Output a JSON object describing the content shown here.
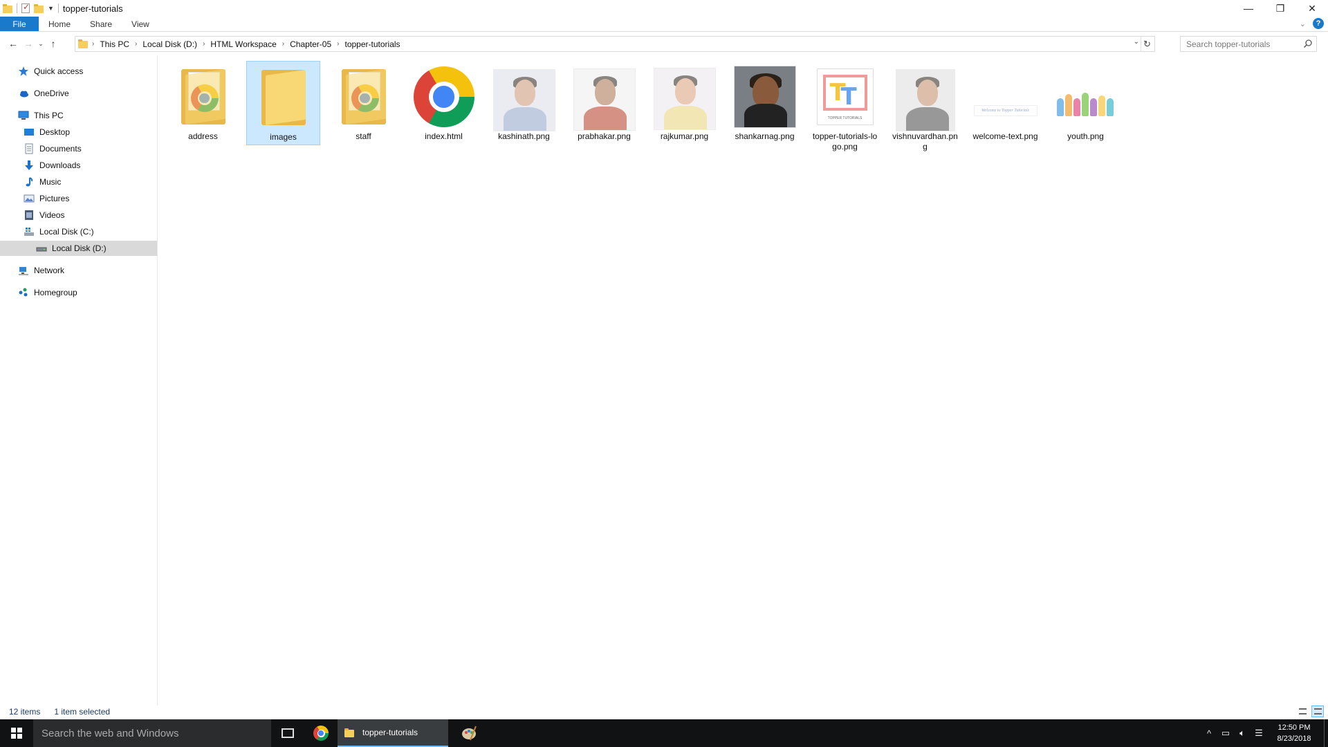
{
  "window": {
    "title": "topper-tutorials",
    "controls": [
      "minimize",
      "restore",
      "close"
    ]
  },
  "ribbon": {
    "tabs": [
      "File",
      "Home",
      "Share",
      "View"
    ]
  },
  "address": {
    "crumbs": [
      "This PC",
      "Local Disk (D:)",
      "HTML Workspace",
      "Chapter-05",
      "topper-tutorials"
    ],
    "search_placeholder": "Search topper-tutorials"
  },
  "sidebar": {
    "items": [
      {
        "label": "Quick access",
        "icon": "star-icon"
      },
      {
        "label": "OneDrive",
        "icon": "cloud-icon"
      },
      {
        "label": "This PC",
        "icon": "computer-icon"
      },
      {
        "label": "Desktop",
        "icon": "desktop-icon"
      },
      {
        "label": "Documents",
        "icon": "documents-icon"
      },
      {
        "label": "Downloads",
        "icon": "downloads-icon"
      },
      {
        "label": "Music",
        "icon": "music-icon"
      },
      {
        "label": "Pictures",
        "icon": "pictures-icon"
      },
      {
        "label": "Videos",
        "icon": "videos-icon"
      },
      {
        "label": "Local Disk (C:)",
        "icon": "drive-icon"
      },
      {
        "label": "Local Disk (D:)",
        "icon": "drive-icon",
        "selected": true
      },
      {
        "label": "Network",
        "icon": "network-icon"
      },
      {
        "label": "Homegroup",
        "icon": "homegroup-icon"
      }
    ]
  },
  "files": [
    {
      "name": "address",
      "kind": "folder-chrome"
    },
    {
      "name": "images",
      "kind": "folder",
      "selected": true
    },
    {
      "name": "staff",
      "kind": "folder-chrome"
    },
    {
      "name": "index.html",
      "kind": "chrome-html"
    },
    {
      "name": "kashinath.png",
      "kind": "photo"
    },
    {
      "name": "prabhakar.png",
      "kind": "photo"
    },
    {
      "name": "rajkumar.png",
      "kind": "photo"
    },
    {
      "name": "shankarnag.png",
      "kind": "photo"
    },
    {
      "name": "topper-tutorials-logo.png",
      "kind": "logo"
    },
    {
      "name": "vishnuvardhan.png",
      "kind": "photo"
    },
    {
      "name": "welcome-text.png",
      "kind": "text-image"
    },
    {
      "name": "youth.png",
      "kind": "youth-image"
    }
  ],
  "thumb_text": {
    "logo_caption": "TOPPER TUTORIALS",
    "welcome_text": "Welcome to Topper Tutorials"
  },
  "status": {
    "count": "12 items",
    "selection": "1 item selected"
  },
  "taskbar": {
    "search_text": "Search the web and Windows",
    "active_app": "topper-tutorials",
    "time": "12:50 PM",
    "date": "8/23/2018"
  },
  "colors": {
    "accent": "#1979ca",
    "selection_bg": "#cce8ff",
    "selection_border": "#99d1ff",
    "taskbar": "#101214"
  }
}
